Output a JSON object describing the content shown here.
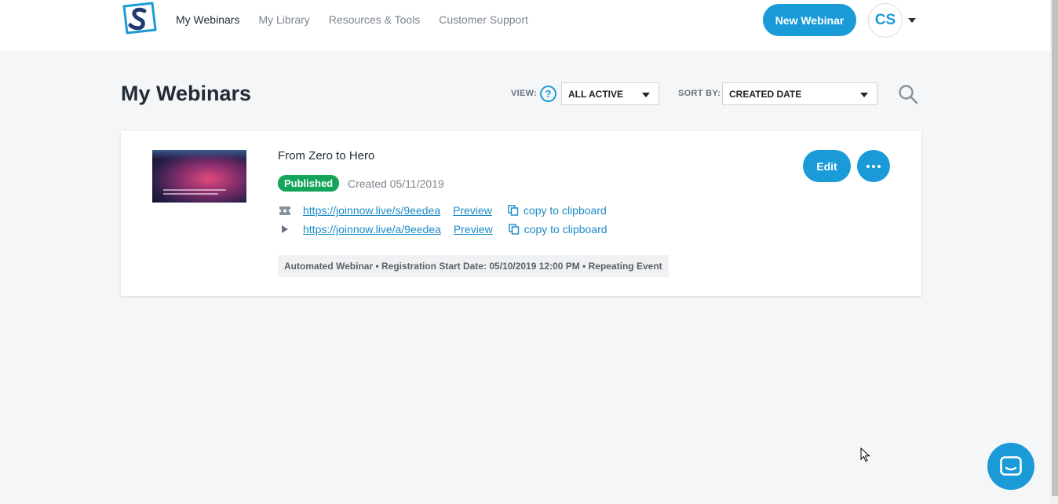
{
  "nav": {
    "items": [
      {
        "label": "My Webinars",
        "active": true
      },
      {
        "label": "My Library",
        "active": false
      },
      {
        "label": "Resources & Tools",
        "active": false
      },
      {
        "label": "Customer Support",
        "active": false
      }
    ],
    "new_button": "New Webinar",
    "avatar_initials": "CS"
  },
  "page": {
    "title": "My Webinars",
    "view_label": "VIEW:",
    "help_symbol": "?",
    "view_value": "ALL ACTIVE",
    "sort_label": "SORT BY:",
    "sort_value": "CREATED DATE"
  },
  "webinar": {
    "title": "From Zero to Hero",
    "status": "Published",
    "created": "Created 05/11/2019",
    "links": [
      {
        "icon": "ticket-icon",
        "url": "https://joinnow.live/s/9eedea",
        "preview": "Preview",
        "copy": "copy to clipboard"
      },
      {
        "icon": "play-icon",
        "url": "https://joinnow.live/a/9eedea",
        "preview": "Preview",
        "copy": "copy to clipboard"
      }
    ],
    "meta": "Automated Webinar • Registration Start Date: 05/10/2019 12:00 PM • Repeating Event",
    "edit_label": "Edit"
  },
  "colors": {
    "accent": "#1a9bd7",
    "published": "#14a55a",
    "background": "#f5f6f8"
  }
}
